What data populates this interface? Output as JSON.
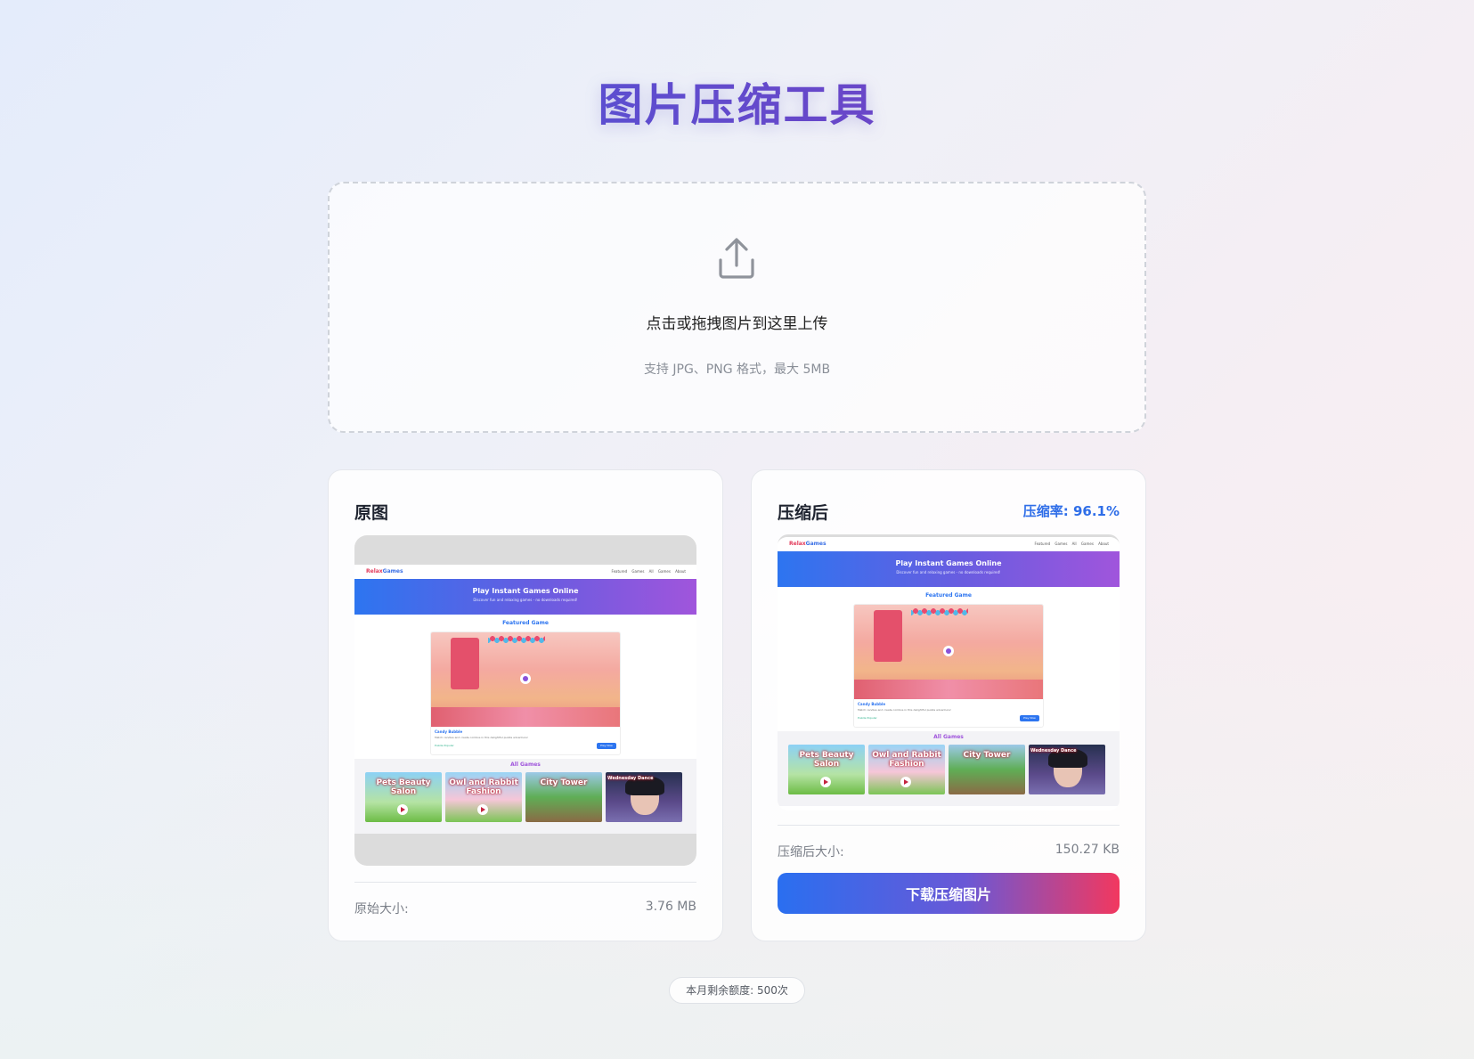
{
  "page": {
    "title": "图片压缩工具"
  },
  "upload": {
    "icon": "upload-icon",
    "prompt": "点击或拖拽图片到这里上传",
    "hint": "支持 JPG、PNG 格式，最大 5MB"
  },
  "original": {
    "title": "原图",
    "size_label": "原始大小:",
    "size_value": "3.76 MB"
  },
  "compressed": {
    "title": "压缩后",
    "ratio": "压缩率: 96.1%",
    "size_label": "压缩后大小:",
    "size_value": "150.27 KB",
    "download_label": "下载压缩图片"
  },
  "quota": {
    "text": "本月剩余额度: 500次"
  },
  "preview_site": {
    "logo_part1": "Relax",
    "logo_part2": "Games",
    "nav_links": "Featured Games   All Games   About",
    "hero_title": "Play Instant Games Online",
    "hero_subtitle": "Discover fun and relaxing games - no downloads required!",
    "featured_heading": "Featured Game",
    "featured_game_title": "Candy Bubble",
    "featured_game_desc": "Match candies and create combos in this delightful puzzle adventure!",
    "featured_game_tags": "Puzzle  Popular",
    "play_button": "Play Now",
    "all_games_heading": "All Games",
    "thumbs": [
      {
        "label": "Pets Beauty Salon"
      },
      {
        "label": "Owl and Rabbit Fashion"
      },
      {
        "label": "City Tower"
      },
      {
        "label": "Wednesday Dance"
      }
    ]
  },
  "colors": {
    "title_gradient_start": "#3f5fe0",
    "title_gradient_end": "#7b43b8",
    "accent_blue": "#2f6ee8",
    "button_gradient_start": "#2a6ff0",
    "button_gradient_end": "#f2385f"
  }
}
